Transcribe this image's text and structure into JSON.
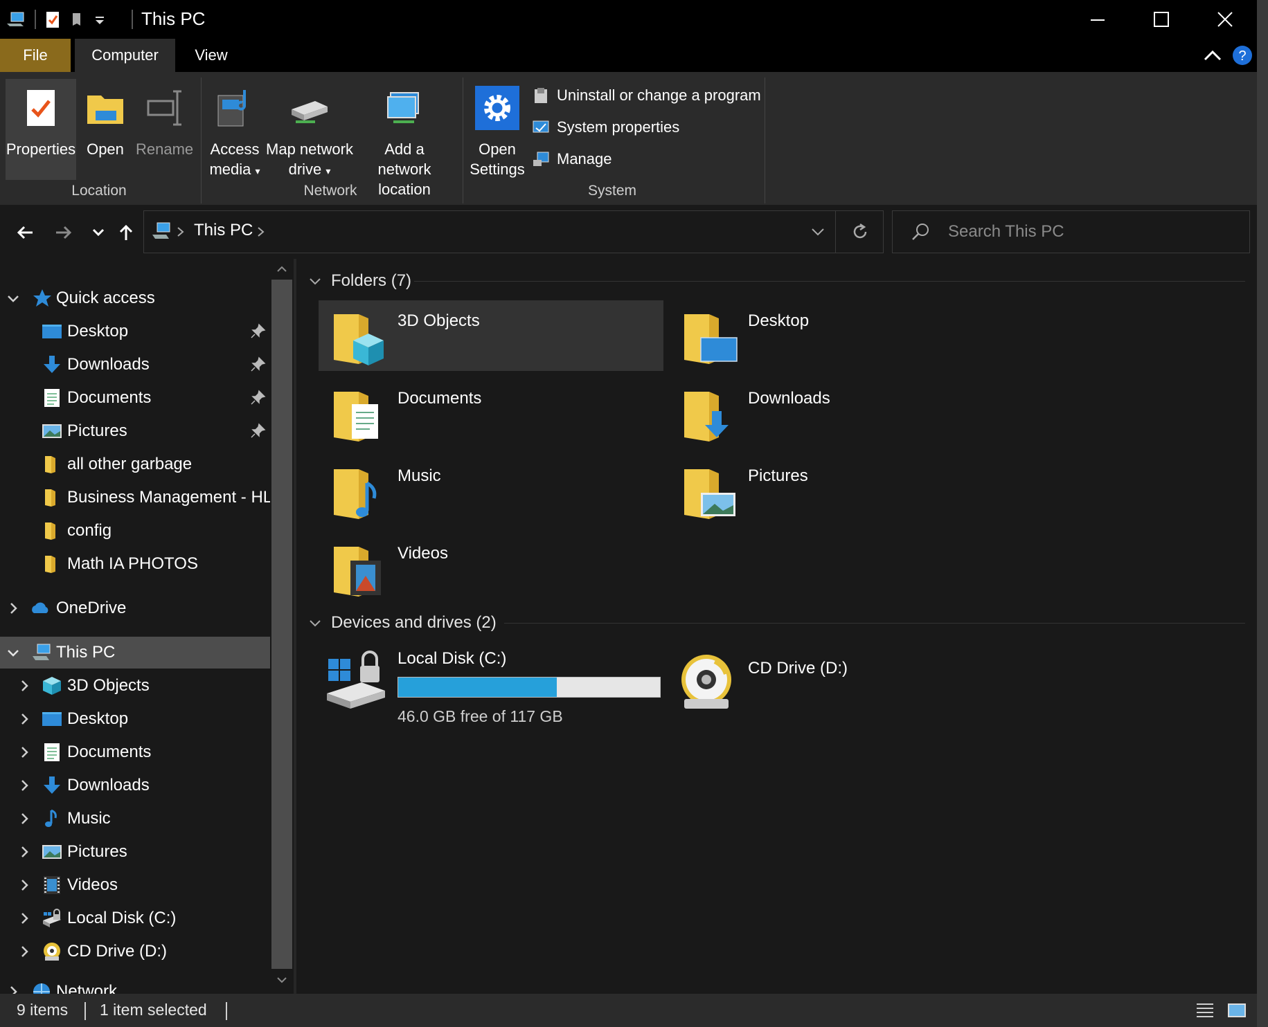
{
  "window": {
    "title": "This PC"
  },
  "ribbon": {
    "tabs": [
      "File",
      "Computer",
      "View"
    ],
    "location": {
      "properties": "Properties",
      "open": "Open",
      "rename": "Rename",
      "group": "Location"
    },
    "network": {
      "access_media": "Access",
      "access_media_2": "media",
      "map_drive": "Map network",
      "map_drive_2": "drive",
      "add_location": "Add a network",
      "add_location_2": "location",
      "group": "Network"
    },
    "system": {
      "open_settings": "Open",
      "open_settings_2": "Settings",
      "uninstall": "Uninstall or change a program",
      "sys_props": "System properties",
      "manage": "Manage",
      "group": "System"
    }
  },
  "address": {
    "path": "This PC",
    "search_placeholder": "Search This PC"
  },
  "nav": {
    "quick_access": "Quick access",
    "quick_items": [
      {
        "label": "Desktop",
        "icon": "desktop-icon",
        "pinned": true
      },
      {
        "label": "Downloads",
        "icon": "download-arrow-icon",
        "pinned": true
      },
      {
        "label": "Documents",
        "icon": "document-icon",
        "pinned": true
      },
      {
        "label": "Pictures",
        "icon": "picture-icon",
        "pinned": true
      },
      {
        "label": "all other garbage",
        "icon": "folder-icon",
        "pinned": false
      },
      {
        "label": "Business Management - HL",
        "icon": "folder-icon",
        "pinned": false
      },
      {
        "label": "config",
        "icon": "folder-icon",
        "pinned": false
      },
      {
        "label": "Math IA PHOTOS",
        "icon": "folder-icon",
        "pinned": false
      }
    ],
    "onedrive": "OneDrive",
    "this_pc": "This PC",
    "pc_items": [
      {
        "label": "3D Objects",
        "icon": "cube-icon"
      },
      {
        "label": "Desktop",
        "icon": "desktop-icon"
      },
      {
        "label": "Documents",
        "icon": "document-icon"
      },
      {
        "label": "Downloads",
        "icon": "download-arrow-icon"
      },
      {
        "label": "Music",
        "icon": "music-note-icon"
      },
      {
        "label": "Pictures",
        "icon": "picture-icon"
      },
      {
        "label": "Videos",
        "icon": "film-icon"
      },
      {
        "label": "Local Disk (C:)",
        "icon": "hard-drive-icon"
      },
      {
        "label": "CD Drive (D:)",
        "icon": "cd-drive-icon"
      }
    ],
    "network": "Network"
  },
  "content": {
    "folders_header": "Folders (7)",
    "folders": [
      {
        "label": "3D Objects",
        "icon": "folder-3d-objects-icon"
      },
      {
        "label": "Desktop",
        "icon": "folder-desktop-icon"
      },
      {
        "label": "Documents",
        "icon": "folder-documents-icon"
      },
      {
        "label": "Downloads",
        "icon": "folder-downloads-icon"
      },
      {
        "label": "Music",
        "icon": "folder-music-icon"
      },
      {
        "label": "Pictures",
        "icon": "folder-pictures-icon"
      },
      {
        "label": "Videos",
        "icon": "folder-videos-icon"
      }
    ],
    "devices_header": "Devices and drives (2)",
    "drives": [
      {
        "label": "Local Disk (C:)",
        "free": "46.0 GB free of 117 GB",
        "used_fraction": 0.607
      },
      {
        "label": "CD Drive (D:)"
      }
    ]
  },
  "status": {
    "items": "9 items",
    "selected": "1 item selected"
  },
  "colors": {
    "accent": "#26a0da",
    "file_tab": "#8a6a1c",
    "folder": "#f0c94a"
  }
}
